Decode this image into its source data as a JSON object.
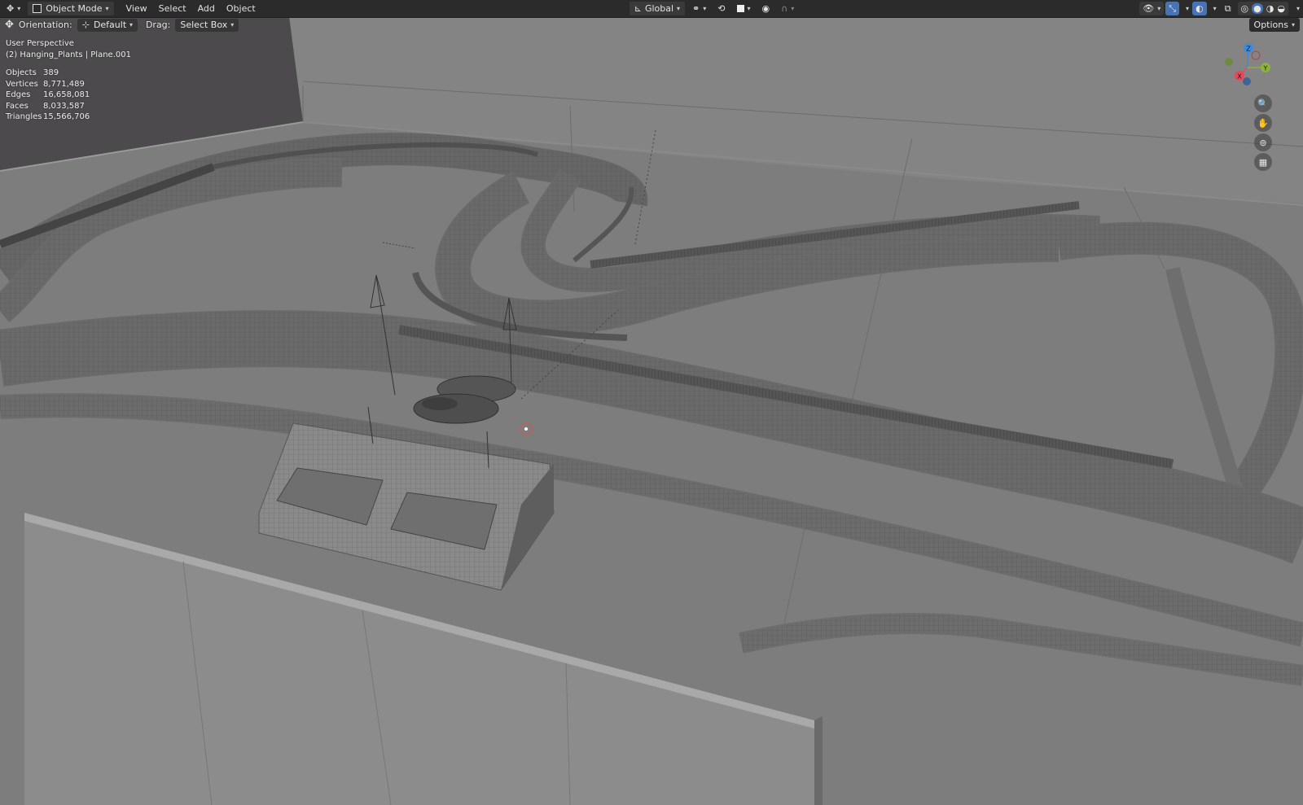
{
  "header": {
    "mode": "Object Mode",
    "menus": [
      "View",
      "Select",
      "Add",
      "Object"
    ],
    "transform_orientation": "Global"
  },
  "tool_settings": {
    "orientation_label": "Orientation:",
    "orientation_value": "Default",
    "drag_label": "Drag:",
    "drag_value": "Select Box"
  },
  "options_label": "Options",
  "viewport": {
    "view_name": "User Perspective",
    "active_object": "(2) Hanging_Plants | Plane.001",
    "stats": [
      {
        "label": "Objects",
        "value": "389"
      },
      {
        "label": "Vertices",
        "value": "8,771,489"
      },
      {
        "label": "Edges",
        "value": "16,658,081"
      },
      {
        "label": "Faces",
        "value": "8,033,587"
      },
      {
        "label": "Triangles",
        "value": "15,566,706"
      }
    ]
  },
  "gizmo": {
    "x": "X",
    "y": "Y",
    "z": "Z"
  },
  "colors": {
    "axis_x": "#e8475c",
    "axis_y": "#8ab23c",
    "axis_z": "#3d8be0",
    "accent": "#4772b3"
  }
}
